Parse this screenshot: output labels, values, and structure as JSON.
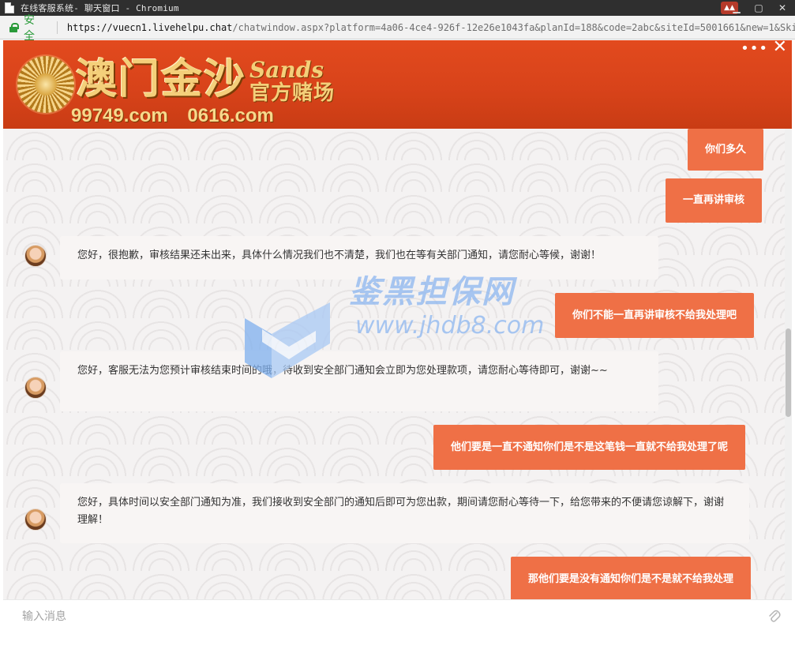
{
  "window": {
    "title": "在线客服系统- 聊天窗口 - Chromium"
  },
  "addressbar": {
    "secure_label": "安全",
    "url_host": "https://vuecn1.livehelpu.chat",
    "url_rest": "/chatwindow.aspx?platform=4a06-4ce4-926f-12e26e1043fa&planId=188&code=2abc&siteId=5001661&new=1&Skil…"
  },
  "banner": {
    "brand_cn": "澳门金沙",
    "brand_en": "Sands",
    "brand_sub": "官方赌场",
    "domains": "99749.com 0616.com",
    "more": "•••",
    "close": "✕"
  },
  "messages": [
    {
      "from": "user",
      "text": "你们多久"
    },
    {
      "from": "user",
      "text": "一直再讲审核"
    },
    {
      "from": "agent",
      "text": "您好，很抱歉，审核结果还未出来，具体什么情况我们也不清楚，我们也在等有关部门通知，请您耐心等候，谢谢！"
    },
    {
      "from": "user",
      "text": "你们不能一直再讲审核不给我处理吧"
    },
    {
      "from": "agent",
      "text": "您好，客服无法为您预计审核结束时间的哦，待收到安全部门通知会立即为您处理款项，请您耐心等待即可，谢谢~~"
    },
    {
      "from": "user",
      "text": "他们要是一直不通知你们是不是这笔钱一直就不给我处理了呢"
    },
    {
      "from": "agent",
      "text": "您好，具体时间以安全部门通知为准，我们接收到安全部门的通知后即可为您出款，期间请您耐心等待一下，给您带来的不便请您谅解下，谢谢理解！"
    },
    {
      "from": "user",
      "text": "那他们要是没有通知你们是不是就不给我处理"
    }
  ],
  "watermark": {
    "cn": "鉴黑担保网",
    "url": "www.jhdb8.com"
  },
  "input": {
    "placeholder": "输入消息"
  }
}
